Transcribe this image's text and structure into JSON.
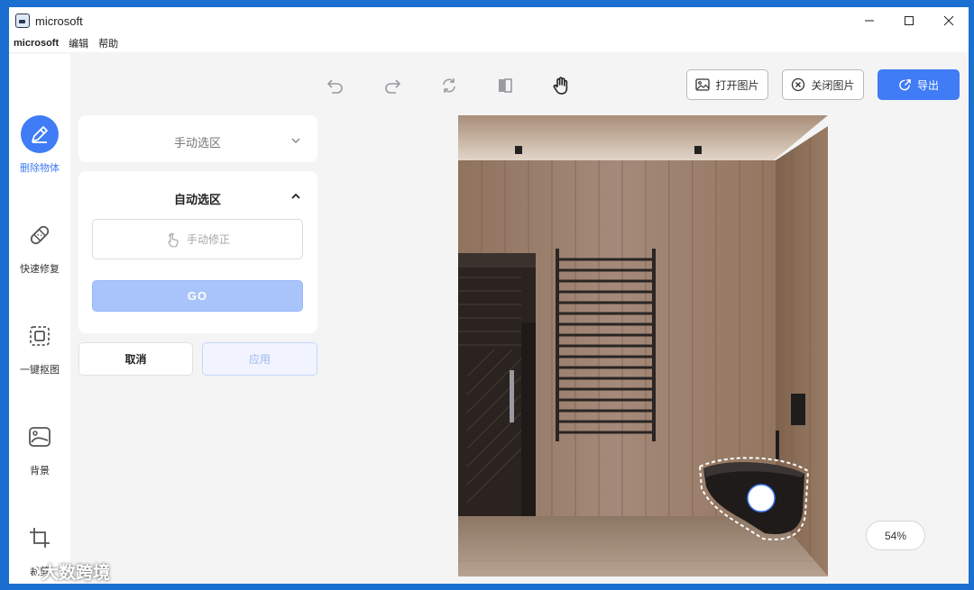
{
  "window": {
    "title": "microsoft"
  },
  "menu": {
    "items": [
      "microsoft",
      "编辑",
      "帮助"
    ]
  },
  "sidebar": {
    "items": [
      {
        "label": "删除物体",
        "icon": "pencil-eraser-icon",
        "active": true
      },
      {
        "label": "快速修复",
        "icon": "bandage-icon",
        "active": false
      },
      {
        "label": "一键抠图",
        "icon": "cutout-icon",
        "active": false
      },
      {
        "label": "背景",
        "icon": "image-background-icon",
        "active": false
      },
      {
        "label": "裁剪",
        "icon": "crop-icon",
        "active": false
      }
    ]
  },
  "toolbar": {
    "icons": [
      "undo-icon",
      "redo-icon",
      "reset-icon",
      "compare-icon",
      "hand-icon"
    ],
    "open_image": "打开图片",
    "close_image": "关闭图片",
    "export": "导出"
  },
  "panel": {
    "manual_select": {
      "title": "手动选区",
      "expanded": false
    },
    "auto_select": {
      "title": "自动选区",
      "expanded": true,
      "manual_fix_label": "手动修正",
      "go_label": "GO"
    },
    "cancel_label": "取消",
    "apply_label": "应用"
  },
  "canvas": {
    "zoom": "54%"
  },
  "watermark": {
    "text": "大数跨境"
  },
  "colors": {
    "accent": "#3f7cf5",
    "go_disabled": "#a9c3fb",
    "titlebar_border": "#1a6fd0"
  }
}
